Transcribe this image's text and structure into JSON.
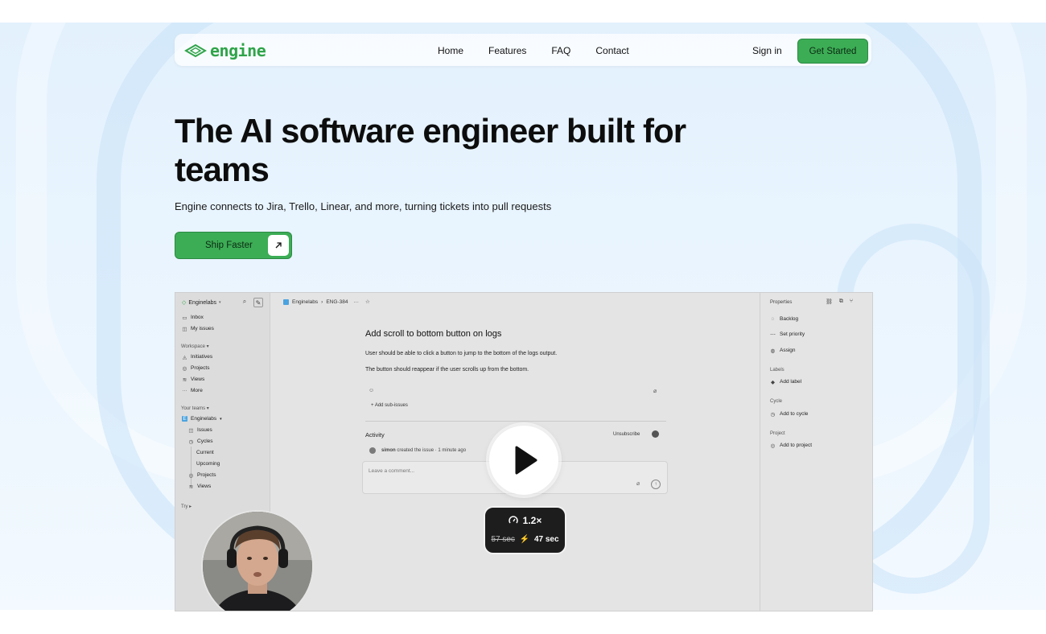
{
  "brand": {
    "logo_text": "engine",
    "accent": "#3cad55"
  },
  "nav": {
    "links": [
      "Home",
      "Features",
      "FAQ",
      "Contact"
    ],
    "sign_in": "Sign in",
    "cta": "Get Started"
  },
  "hero": {
    "title": "The AI software engineer built for teams",
    "subtitle": "Engine connects to Jira, Trello, Linear, and more, turning tickets into pull requests",
    "button": "Ship Faster"
  },
  "app": {
    "workspace": "Enginelabs",
    "sidebar": {
      "top": [
        "Inbox",
        "My issues"
      ],
      "workspace_head": "Workspace",
      "workspace_items": [
        "Initiatives",
        "Projects",
        "Views",
        "More"
      ],
      "teams_head": "Your teams",
      "team": "Enginelabs",
      "team_items": [
        "Issues",
        "Cycles",
        "Current",
        "Upcoming",
        "Projects",
        "Views"
      ],
      "try": "Try"
    },
    "breadcrumb": {
      "team": "Enginelabs",
      "issue": "ENG-384"
    },
    "issue": {
      "title": "Add scroll to bottom button on logs",
      "p1": "User should be able to click a button to jump to the bottom of the logs output.",
      "p2": "The button should reappear if the user scrolls up from the bottom.",
      "add_sub": "Add sub-issues",
      "activity": "Activity",
      "unsubscribe": "Unsubscribe",
      "activity_user": "simon",
      "activity_text": "created the issue · 1 minute ago",
      "comment_placeholder": "Leave a comment..."
    },
    "properties": {
      "head": "Properties",
      "status": "Backlog",
      "priority": "Set priority",
      "assign": "Assign",
      "labels_head": "Labels",
      "add_label": "Add label",
      "cycle_head": "Cycle",
      "add_cycle": "Add to cycle",
      "project_head": "Project",
      "add_project": "Add to project"
    }
  },
  "video": {
    "speed": "1.2×",
    "time_old": "57 sec",
    "time_new": "47 sec"
  }
}
